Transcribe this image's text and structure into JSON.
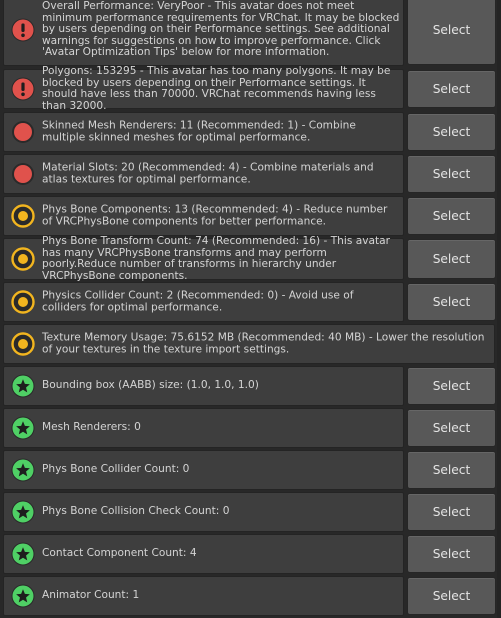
{
  "select_label": "Select",
  "colors": {
    "error": "#e0524c",
    "warning": "#f2b51f",
    "success": "#4fd065"
  },
  "messages": [
    {
      "status": "error-exclamation",
      "text": "Overall Performance: VeryPoor - This avatar does not meet minimum performance requirements for VRChat. It may be blocked by users depending on their Performance settings. See additional warnings for suggestions on how to improve performance. Click 'Avatar Optimization Tips' below for more information.",
      "has_select": true
    },
    {
      "status": "error-exclamation",
      "text": "Polygons: 153295 - This avatar has too many polygons. It may be blocked by users depending on their Performance settings. It should have less than 70000. VRChat recommends having less than 32000.",
      "has_select": true
    },
    {
      "status": "error-circle",
      "text": "Skinned Mesh Renderers: 11 (Recommended: 1) - Combine multiple skinned meshes for optimal performance.",
      "has_select": true
    },
    {
      "status": "error-circle",
      "text": "Material Slots: 20 (Recommended: 4) - Combine materials and atlas textures for optimal performance.",
      "has_select": true
    },
    {
      "status": "warning-circle",
      "text": "Phys Bone Components: 13 (Recommended: 4) - Reduce number of VRCPhysBone components for better performance.",
      "has_select": true
    },
    {
      "status": "warning-circle",
      "text": "Phys Bone Transform Count: 74 (Recommended: 16) - This avatar has many VRCPhysBone transforms and may perform poorly.Reduce number of transforms in hierarchy under VRCPhysBone components.",
      "has_select": true
    },
    {
      "status": "warning-circle",
      "text": "Physics Collider Count: 2 (Recommended: 0) - Avoid use of colliders for optimal performance.",
      "has_select": true
    },
    {
      "status": "warning-circle",
      "text": "Texture Memory Usage: 75.6152 MB (Recommended: 40 MB) - Lower the resolution of your textures in the texture import settings.",
      "has_select": false
    },
    {
      "status": "success-star",
      "text": "Bounding box (AABB) size: (1.0, 1.0, 1.0)",
      "has_select": true
    },
    {
      "status": "success-star",
      "text": "Mesh Renderers: 0",
      "has_select": true
    },
    {
      "status": "success-star",
      "text": "Phys Bone Collider Count: 0",
      "has_select": true
    },
    {
      "status": "success-star",
      "text": "Phys Bone Collision Check Count: 0",
      "has_select": true
    },
    {
      "status": "success-star",
      "text": "Contact Component Count: 4",
      "has_select": true
    },
    {
      "status": "success-star",
      "text": "Animator Count: 1",
      "has_select": true
    }
  ]
}
